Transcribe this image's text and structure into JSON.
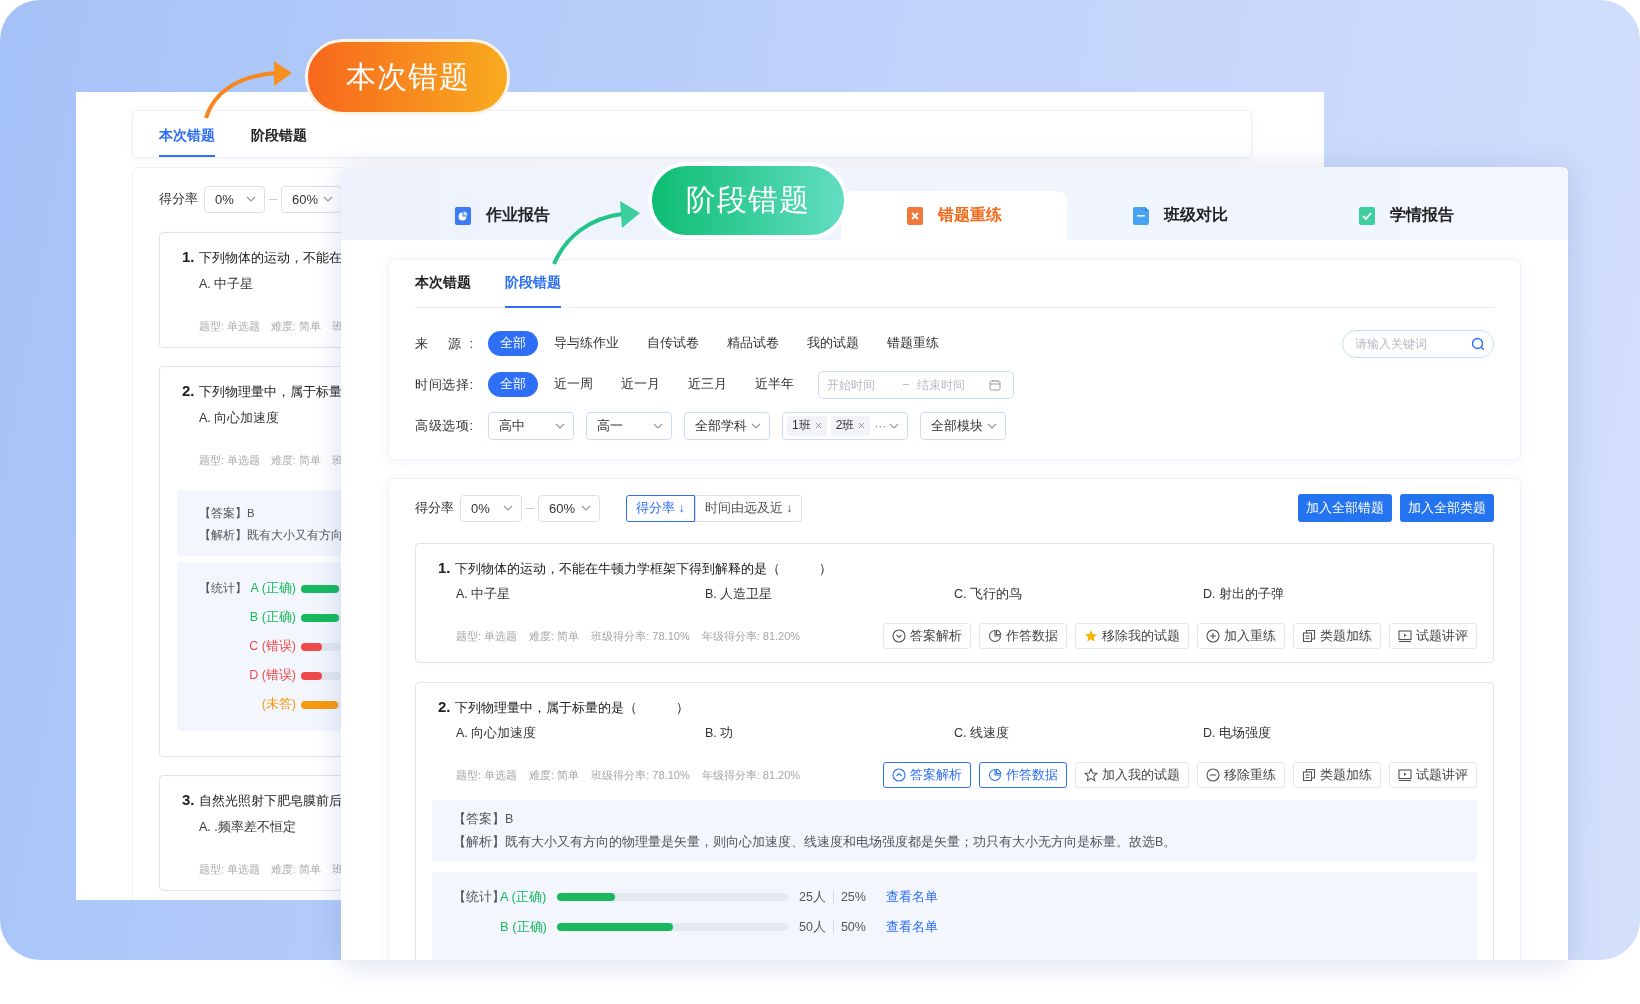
{
  "callouts": [
    {
      "text": "本次错题",
      "kind": "current"
    },
    {
      "text": "阶段错题",
      "kind": "stage"
    }
  ],
  "back_panel": {
    "tabs": [
      {
        "label": "本次错题",
        "selected": true
      },
      {
        "label": "阶段错题",
        "selected": false
      }
    ],
    "score_filter": {
      "label": "得分率",
      "min": "0%",
      "max": "60%"
    },
    "questions": [
      {
        "number": "1.",
        "text": "下列物体的运动，不能在",
        "options": [
          "A. 中子星"
        ],
        "meta": [
          "题型: 单选题",
          "难度: 简单",
          "班"
        ]
      },
      {
        "number": "2.",
        "text": "下列物理量中，属于标量",
        "options": [
          "A. 向心加速度"
        ],
        "meta": [
          "题型: 单选题",
          "难度: 简单",
          "班"
        ],
        "answer": {
          "answer": "【答案】B",
          "analysis": "【解析】既有大小又有方向"
        },
        "stats": {
          "label": "【统计】",
          "rows": [
            {
              "label": "A (正确)",
              "color": "#17b95e",
              "level": 0.95
            },
            {
              "label": "B (正确)",
              "color": "#17b95e",
              "level": 0.95
            },
            {
              "label": "C (错误)",
              "color": "#ee4a4a",
              "level": 0.52
            },
            {
              "label": "D (错误)",
              "color": "#ee4a4a",
              "level": 0.52
            },
            {
              "label": "(未答)",
              "color": "#f7990c",
              "level": 0.93
            }
          ]
        }
      },
      {
        "number": "3.",
        "text": "自然光照射下肥皂膜前后",
        "options": [
          "A. .频率差不恒定"
        ],
        "meta": [
          "题型: 单选题",
          "难度: 简单",
          "班"
        ]
      }
    ]
  },
  "front_panel": {
    "report_tabs": [
      {
        "label": "作业报告",
        "selected": false
      },
      {
        "label": "错题重练",
        "selected": true
      },
      {
        "label": "班级对比",
        "selected": false
      },
      {
        "label": "学情报告",
        "selected": false
      }
    ],
    "sub_tabs": [
      {
        "label": "本次错题",
        "selected": false
      },
      {
        "label": "阶段错题",
        "selected": true
      }
    ],
    "filters": [
      {
        "kind": "chips",
        "label": "来 源:",
        "options": [
          {
            "label": "全部",
            "selected": true
          },
          {
            "label": "导与练作业",
            "selected": false
          },
          {
            "label": "自传试卷",
            "selected": false
          },
          {
            "label": "精品试卷",
            "selected": false
          },
          {
            "label": "我的试题",
            "selected": false
          },
          {
            "label": "错题重练",
            "selected": false
          }
        ],
        "search": {
          "placeholder": "请输入关键词"
        }
      },
      {
        "kind": "chips",
        "label": "时间选择:",
        "options": [
          {
            "label": "全部",
            "selected": true
          },
          {
            "label": "近一周",
            "selected": false
          },
          {
            "label": "近一月",
            "selected": false
          },
          {
            "label": "近三月",
            "selected": false
          },
          {
            "label": "近半年",
            "selected": false
          }
        ],
        "date_range": {
          "start_placeholder": "开始时间",
          "end_placeholder": "结束时间"
        }
      },
      {
        "kind": "selects",
        "label": "高级选项:",
        "selects": [
          {
            "value": "高中"
          },
          {
            "value": "高一"
          },
          {
            "value": "全部学科"
          },
          {
            "tags": [
              "1班",
              "2班"
            ],
            "more": "···"
          },
          {
            "value": "全部模块"
          }
        ]
      }
    ],
    "score_filter": {
      "label": "得分率",
      "min": "0%",
      "max": "60%"
    },
    "sort_buttons": [
      {
        "label": "得分率 ↓",
        "selected": true
      },
      {
        "label": "时间由远及近 ↓",
        "selected": false
      }
    ],
    "actions": [
      "加入全部错题",
      "加入全部类题"
    ],
    "questions": [
      {
        "number": "1.",
        "text": "下列物体的运动，不能在牛顿力学框架下得到解释的是（　　　）",
        "options": [
          "A. 中子星",
          "B. 人造卫星",
          "C. 飞行的鸟",
          "D. 射出的子弹"
        ],
        "meta": [
          "题型: 单选题",
          "难度: 简单",
          "班级得分率: 78.10%",
          "年级得分率: 81.20%"
        ],
        "tools": [
          {
            "kind": "analysis",
            "label": "答案解析",
            "active": false
          },
          {
            "kind": "data",
            "label": "作答数据",
            "active": false
          },
          {
            "kind": "favorite",
            "label": "移除我的试题",
            "active": false,
            "on": true
          },
          {
            "kind": "retrain",
            "label": "加入重练",
            "active": false,
            "on": false
          },
          {
            "kind": "similar",
            "label": "类题加练",
            "active": false
          },
          {
            "kind": "review",
            "label": "试题讲评",
            "active": false
          }
        ]
      },
      {
        "number": "2.",
        "text": "下列物理量中，属于标量的是（　　　）",
        "options": [
          "A. 向心加速度",
          "B. 功",
          "C. 线速度",
          "D. 电场强度"
        ],
        "meta": [
          "题型: 单选题",
          "难度: 简单",
          "班级得分率: 78.10%",
          "年级得分率: 81.20%"
        ],
        "tools": [
          {
            "kind": "analysis",
            "label": "答案解析",
            "active": true
          },
          {
            "kind": "data",
            "label": "作答数据",
            "active": true
          },
          {
            "kind": "favorite",
            "label": "加入我的试题",
            "active": false,
            "on": false
          },
          {
            "kind": "retrain",
            "label": "移除重练",
            "active": false,
            "on": true
          },
          {
            "kind": "similar",
            "label": "类题加练",
            "active": false
          },
          {
            "kind": "review",
            "label": "试题讲评",
            "active": false
          }
        ],
        "answer": {
          "answer": "【答案】B",
          "analysis": "【解析】既有大小又有方向的物理量是矢量，则向心加速度、线速度和电场强度都是矢量；功只有大小无方向是标量。故选B。"
        },
        "stats": {
          "label": "【统计】",
          "rows": [
            {
              "label": "A (正确)",
              "color": "#17b95e",
              "level": 0.25,
              "count": "25人",
              "percent": "25%",
              "link": "查看名单"
            },
            {
              "label": "B (正确)",
              "color": "#17b95e",
              "level": 0.5,
              "count": "50人",
              "percent": "50%",
              "link": "查看名单"
            }
          ]
        }
      }
    ]
  }
}
